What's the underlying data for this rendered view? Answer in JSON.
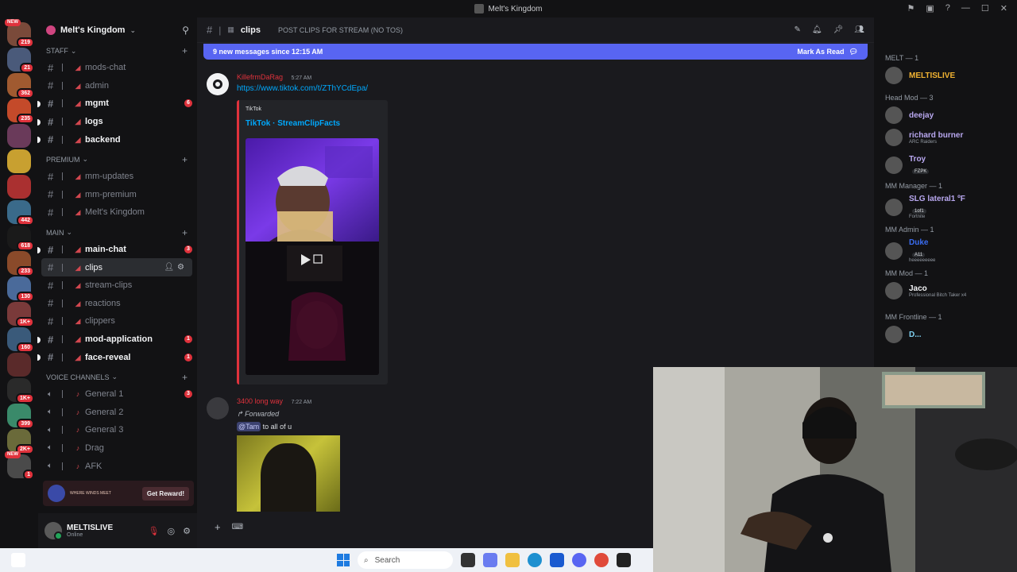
{
  "window": {
    "title": "Melt's Kingdom"
  },
  "servers": [
    {
      "badge": "219",
      "color": "#7a4a3a",
      "new": true
    },
    {
      "badge": "21",
      "color": "#4a5a7a"
    },
    {
      "badge": "362",
      "color": "#a05a30"
    },
    {
      "badge": "235",
      "color": "#c44a2a"
    },
    {
      "badge": "",
      "color": "#6a3a5a"
    },
    {
      "badge": "",
      "color": "#c8a030"
    },
    {
      "badge": "",
      "color": "#aa3030"
    },
    {
      "badge": "442",
      "color": "#3a6a8a"
    },
    {
      "badge": "618",
      "color": "#1a1a1a"
    },
    {
      "badge": "233",
      "color": "#8a4a2a"
    },
    {
      "badge": "130",
      "color": "#4a6a9a"
    },
    {
      "badge": "1K+",
      "color": "#7a3a3a"
    },
    {
      "badge": "160",
      "color": "#3a5a7a"
    },
    {
      "badge": "",
      "color": "#5a2a2a"
    },
    {
      "badge": "1K+",
      "color": "#2a2a2a"
    },
    {
      "badge": "399",
      "color": "#3a8a6a"
    },
    {
      "badge": "2K+",
      "color": "#6a6a3a"
    },
    {
      "badge": "1",
      "color": "#4a4a4a",
      "new": true
    }
  ],
  "guild": {
    "name": "Melt's Kingdom"
  },
  "categories": {
    "staff": "STAFF",
    "premium": "PREMIUM",
    "main": "MAIN",
    "voice": "VOICE CHANNELS"
  },
  "channels": {
    "staff": [
      {
        "name": "mods-chat",
        "unread": false,
        "count": ""
      },
      {
        "name": "admin",
        "unread": false,
        "count": ""
      },
      {
        "name": "mgmt",
        "unread": true,
        "count": "6"
      },
      {
        "name": "logs",
        "unread": true,
        "count": ""
      },
      {
        "name": "backend",
        "unread": true,
        "count": ""
      }
    ],
    "premium": [
      {
        "name": "mm-updates"
      },
      {
        "name": "mm-premium"
      },
      {
        "name": "Melt's Kingdom"
      }
    ],
    "main": [
      {
        "name": "main-chat",
        "unread": true,
        "count": "3"
      },
      {
        "name": "clips",
        "active": true
      },
      {
        "name": "stream-clips"
      },
      {
        "name": "reactions"
      },
      {
        "name": "clippers"
      },
      {
        "name": "mod-application",
        "unread": true,
        "count": "1"
      },
      {
        "name": "face-reveal",
        "unread": true,
        "count": "1"
      }
    ],
    "voice": [
      {
        "name": "General 1",
        "count": "3"
      },
      {
        "name": "General 2"
      },
      {
        "name": "General 3"
      },
      {
        "name": "Drag"
      },
      {
        "name": "AFK"
      }
    ]
  },
  "promo": {
    "text": "WHERE WINDS MEET",
    "button": "Get Reward!"
  },
  "user": {
    "name": "MELTISLIVE",
    "status": "Online"
  },
  "chat": {
    "channel": "clips",
    "topic": "POST CLIPS FOR STREAM (NO TOS)",
    "new_messages": "9 new messages since 12:15 AM",
    "mark_read": "Mark As Read",
    "messages": [
      {
        "author": "KillefrmDaRag",
        "time": "5:27 AM",
        "link": "https://www.tiktok.com/t/ZThYCdEpa/",
        "embed_provider": "TikTok",
        "embed_title": "TikTok · StreamClipFacts"
      },
      {
        "author": "3400 long way",
        "time": "7:22 AM",
        "forwarded": "Forwarded",
        "mention": "@Tam",
        "text": " to all of u"
      }
    ]
  },
  "search": {
    "placeholder": "Search Melt's Kingdom"
  },
  "members": {
    "groups": [
      {
        "label": "MELT — 1",
        "members": [
          {
            "name": "MELTISLIVE",
            "color": "#f0b232",
            "sub": ""
          }
        ]
      },
      {
        "label": "Head Mod — 3",
        "members": [
          {
            "name": "deejay",
            "color": "#b9a8f0",
            "sub": ""
          },
          {
            "name": "richard burner",
            "color": "#b9a8f0",
            "sub": "ARC Raiders"
          },
          {
            "name": "Troy",
            "color": "#b9a8f0",
            "sub": "",
            "tag": "FZPK"
          }
        ]
      },
      {
        "label": "MM Manager — 1",
        "members": [
          {
            "name": "SLG lateral1 ºF",
            "color": "#b9a8f0",
            "sub": "Fortnite",
            "tag": "1of1"
          }
        ]
      },
      {
        "label": "MM Admin — 1",
        "members": [
          {
            "name": "Duke",
            "color": "#3a6cf0",
            "sub": "heeeeeeeee",
            "tag": "A11"
          }
        ]
      },
      {
        "label": "MM Mod — 1",
        "members": [
          {
            "name": "Jaco",
            "color": "#f2f3f5",
            "sub": "Professional Bitch Taker x4"
          }
        ]
      },
      {
        "label": "MM Frontline — 1",
        "members": [
          {
            "name": "D...",
            "color": "#7ed0f0",
            "sub": ""
          }
        ]
      }
    ]
  },
  "taskbar": {
    "search": "Search"
  }
}
